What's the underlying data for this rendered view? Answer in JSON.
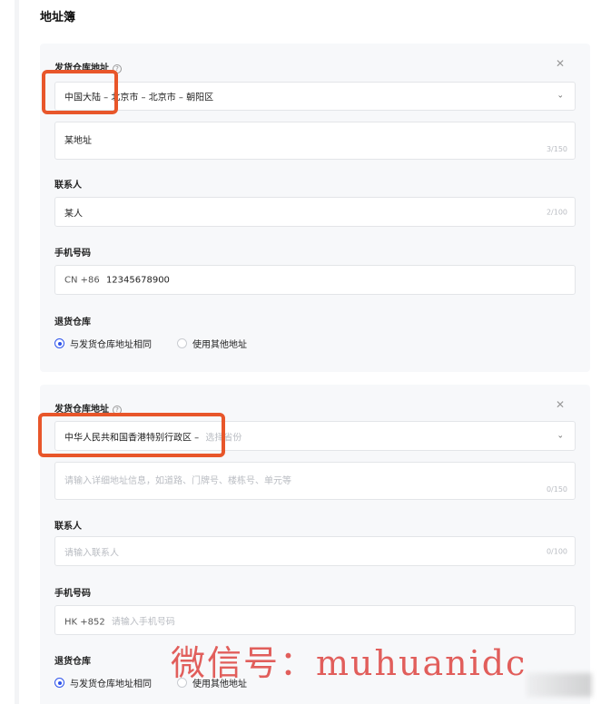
{
  "page_title": "地址簿",
  "colors": {
    "accent": "#2f54eb",
    "highlight": "#e8562a",
    "watermark": "#e0514e"
  },
  "cards": [
    {
      "ship_label": "发货仓库地址",
      "region": "中国大陆 – 北京市 – 北京市 – 朝阳区",
      "region_placeholder": "",
      "address_value": "某地址",
      "address_placeholder": "",
      "address_counter": "3/150",
      "contact_label": "联系人",
      "contact_value": "某人",
      "contact_placeholder": "",
      "contact_counter": "2/100",
      "phone_label": "手机号码",
      "phone_prefix": "CN +86",
      "phone_value": "12345678900",
      "phone_placeholder": "",
      "return_label": "退货仓库",
      "opt_same": "与发货仓库地址相同",
      "opt_other": "使用其他地址"
    },
    {
      "ship_label": "发货仓库地址",
      "region": "中华人民共和国香港特别行政区 –",
      "region_placeholder": "选择省份",
      "address_value": "",
      "address_placeholder": "请输入详细地址信息，如道路、门牌号、楼栋号、单元等",
      "address_counter": "0/150",
      "contact_label": "联系人",
      "contact_value": "",
      "contact_placeholder": "请输入联系人",
      "contact_counter": "0/100",
      "phone_label": "手机号码",
      "phone_prefix": "HK +852",
      "phone_value": "",
      "phone_placeholder": "请输入手机号码",
      "return_label": "退货仓库",
      "opt_same": "与发货仓库地址相同",
      "opt_other": "使用其他地址"
    }
  ],
  "watermark": "微信号：muhuanidc"
}
